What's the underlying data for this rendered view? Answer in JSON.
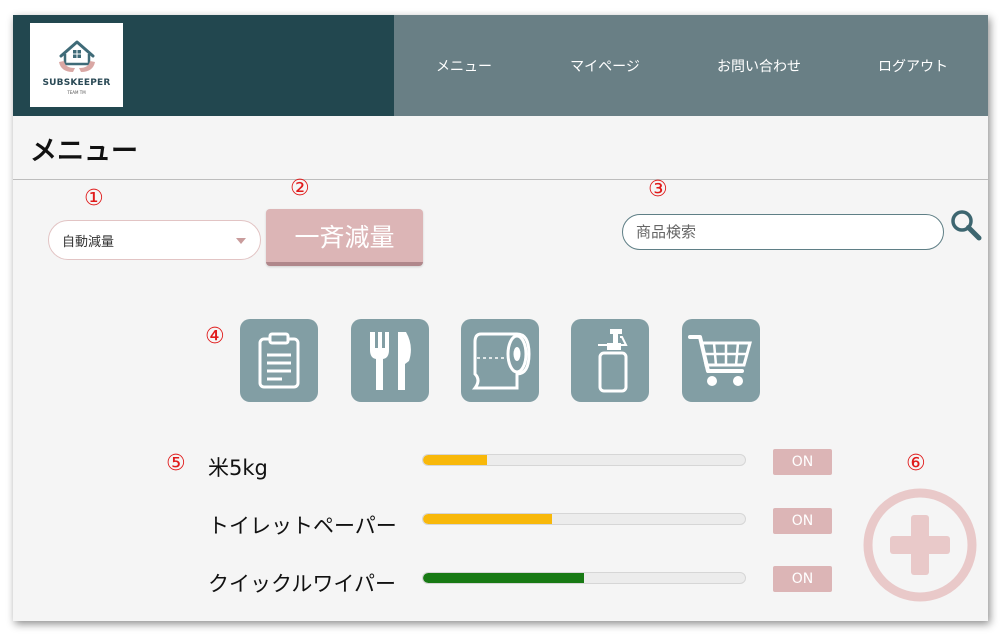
{
  "brand": {
    "name": "SUBSKEEPER",
    "tagline": "TEAM TM",
    "colors": {
      "header_dark": "#22474f",
      "header_nav": "#697f85",
      "accent_pink": "#dcb5b6",
      "icon_teal": "#829ea4"
    }
  },
  "nav": {
    "items": [
      {
        "label": "メニュー"
      },
      {
        "label": "マイページ"
      },
      {
        "label": "お問い合わせ"
      },
      {
        "label": "ログアウト"
      }
    ]
  },
  "page": {
    "title": "メニュー"
  },
  "markers": [
    "①",
    "②",
    "③",
    "④",
    "⑤",
    "⑥"
  ],
  "controls": {
    "mode_select": {
      "value": "自動減量",
      "icon": "chevron-down-icon"
    },
    "bulk_reduce_label": "一斉減量",
    "search": {
      "placeholder": "商品検索",
      "icon": "search-icon"
    }
  },
  "categories": [
    {
      "icon": "clipboard-icon"
    },
    {
      "icon": "fork-knife-icon"
    },
    {
      "icon": "toilet-paper-icon"
    },
    {
      "icon": "pump-bottle-icon"
    },
    {
      "icon": "shopping-cart-icon"
    }
  ],
  "items": [
    {
      "name": "米5kg",
      "level": 0.2,
      "level_color": "#f8b80a",
      "toggle": "ON"
    },
    {
      "name": "トイレットペーパー",
      "level": 0.4,
      "level_color": "#f8b80a",
      "toggle": "ON"
    },
    {
      "name": "クイックルワイパー",
      "level": 0.5,
      "level_color": "#187a14",
      "toggle": "ON"
    }
  ],
  "add_button": {
    "icon": "plus-icon"
  }
}
